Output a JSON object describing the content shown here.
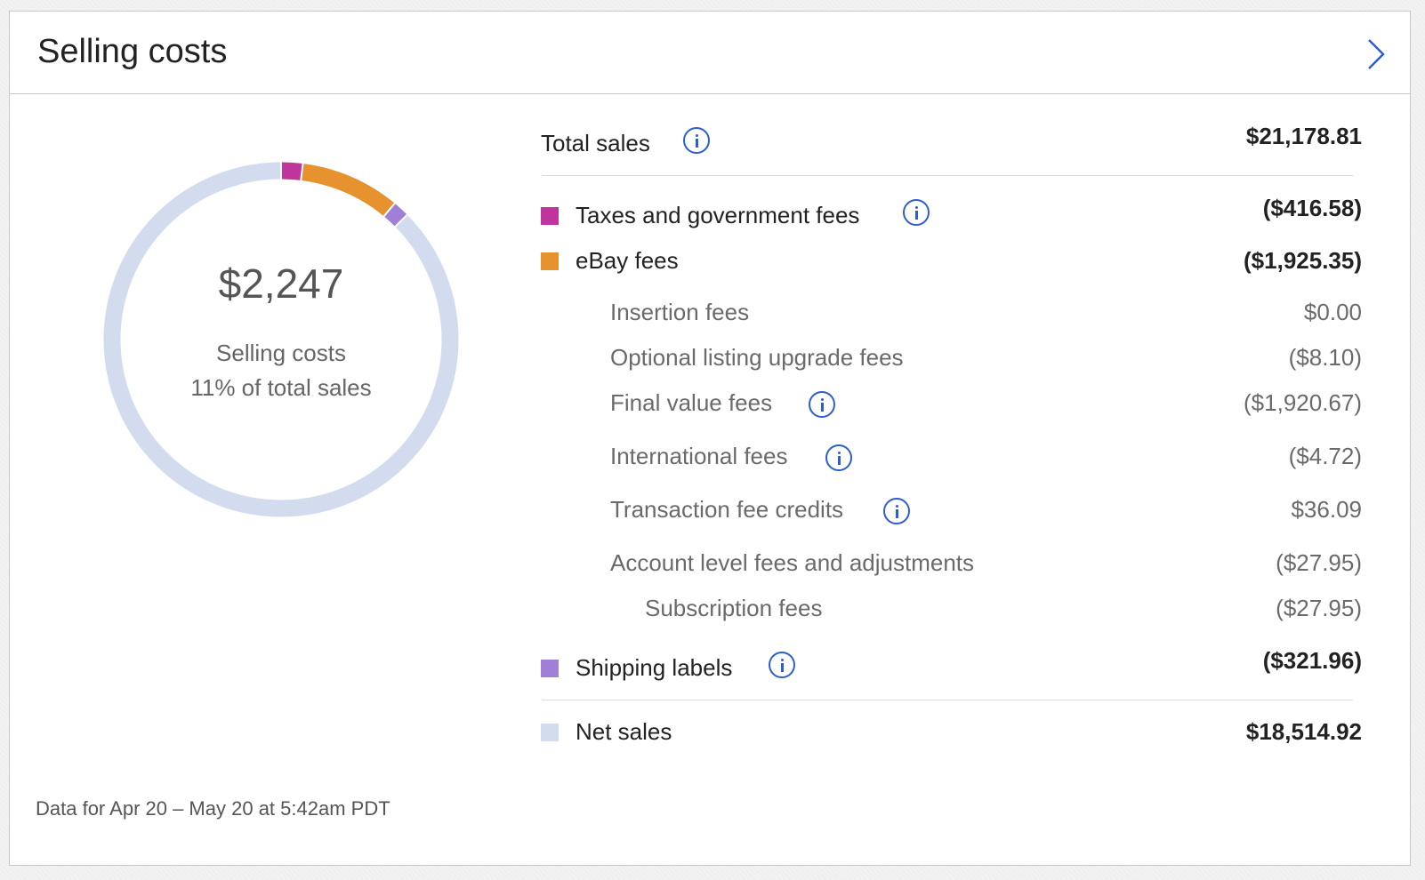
{
  "header": {
    "title": "Selling costs"
  },
  "donut": {
    "amount": "$2,247",
    "label": "Selling costs",
    "percent_label": "11% of total sales"
  },
  "chart_data": {
    "type": "pie",
    "categories": [
      "Taxes and government fees",
      "eBay fees",
      "Shipping labels",
      "Net sales"
    ],
    "values": [
      416.58,
      1925.35,
      321.96,
      18514.92
    ],
    "colors": [
      "#c0349e",
      "#e5922f",
      "#a07fd6",
      "#d3dcef"
    ]
  },
  "breakdown": {
    "total_sales": {
      "label": "Total sales",
      "amount": "$21,178.81"
    },
    "taxes": {
      "label": "Taxes and government fees",
      "amount": "($416.58)",
      "color": "#c0349e"
    },
    "ebay_fees": {
      "label": "eBay fees",
      "amount": "($1,925.35)",
      "color": "#e5922f"
    },
    "insertion": {
      "label": "Insertion fees",
      "amount": "$0.00"
    },
    "optional_upgrade": {
      "label": "Optional listing upgrade fees",
      "amount": "($8.10)"
    },
    "final_value": {
      "label": "Final value fees",
      "amount": "($1,920.67)"
    },
    "international": {
      "label": "International fees",
      "amount": "($4.72)"
    },
    "transaction_credits": {
      "label": "Transaction fee credits",
      "amount": "$36.09"
    },
    "account_level": {
      "label": "Account level fees and adjustments",
      "amount": "($27.95)"
    },
    "subscription": {
      "label": "Subscription fees",
      "amount": "($27.95)"
    },
    "shipping_labels": {
      "label": "Shipping labels",
      "amount": "($321.96)",
      "color": "#a07fd6"
    },
    "net_sales": {
      "label": "Net sales",
      "amount": "$18,514.92",
      "color": "#d3dcef"
    }
  },
  "footer": {
    "text": "Data for Apr 20 – May 20 at 5:42am PDT"
  },
  "icons": {
    "info": "info-icon",
    "chevron": "chevron-right-icon"
  },
  "accent_color": "#2c5ecf"
}
